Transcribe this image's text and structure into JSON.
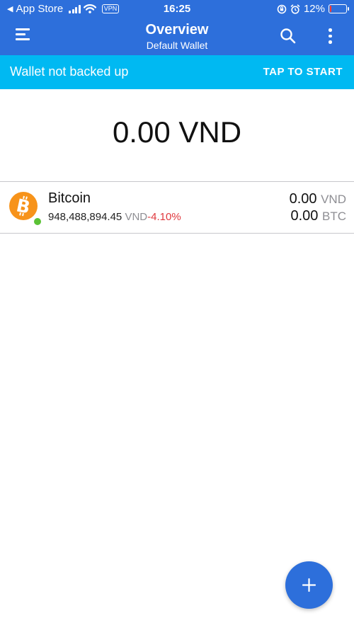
{
  "status_bar": {
    "back_label": "App Store",
    "time": "16:25",
    "vpn_label": "VPN",
    "battery_text": "12%",
    "battery_level": 0.12
  },
  "header": {
    "title": "Overview",
    "subtitle": "Default Wallet",
    "icons": [
      "menu-icon",
      "search-icon",
      "more-vertical-icon"
    ]
  },
  "banner": {
    "message": "Wallet not backed up",
    "action_label": "TAP TO START"
  },
  "total_balance": "0.00 VND",
  "assets": [
    {
      "name": "Bitcoin",
      "price": "948,488,894.45",
      "price_currency": "VND",
      "change": "-4.10%",
      "fiat_balance": "0.00",
      "fiat_unit": "VND",
      "crypto_balance": "0.00",
      "crypto_unit": "BTC",
      "icon": "bitcoin-icon"
    }
  ],
  "colors": {
    "header_bg": "#2d6fdb",
    "banner_bg": "#00b9f2",
    "negative_change": "#e0393e",
    "bitcoin_orange": "#f7931a",
    "online_dot": "#5bc236"
  }
}
